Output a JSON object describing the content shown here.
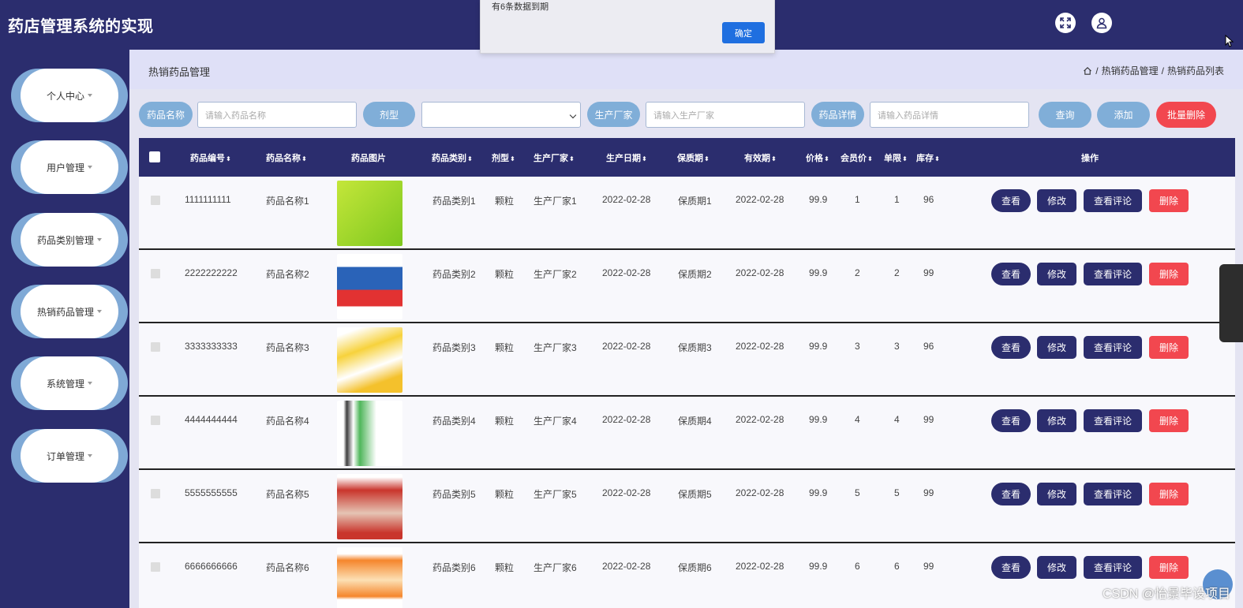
{
  "app": {
    "title": "药店管理系统的实现"
  },
  "dialog": {
    "message": "有6条数据到期",
    "ok_label": "确定"
  },
  "sidebar": {
    "items": [
      {
        "label": "个人中心"
      },
      {
        "label": "用户管理"
      },
      {
        "label": "药品类别管理"
      },
      {
        "label": "热销药品管理"
      },
      {
        "label": "系统管理"
      },
      {
        "label": "订单管理"
      }
    ]
  },
  "breadcrumb": {
    "title": "热销药品管理",
    "path1": "热销药品管理",
    "sep": "/",
    "path2": "热销药品列表"
  },
  "search": {
    "name_label": "药品名称",
    "name_placeholder": "请输入药品名称",
    "form_label": "剂型",
    "maker_label": "生产厂家",
    "maker_placeholder": "请输入生产厂家",
    "detail_label": "药品详情",
    "detail_placeholder": "请输入药品详情",
    "query_label": "查询",
    "add_label": "添加",
    "batch_delete_label": "批量删除"
  },
  "table": {
    "headers": [
      "药品编号",
      "药品名称",
      "药品图片",
      "药品类别",
      "剂型",
      "生产厂家",
      "生产日期",
      "保质期",
      "有效期",
      "价格",
      "会员价",
      "单限",
      "库存",
      "操作"
    ],
    "rows": [
      {
        "code": "1111111111",
        "name": "药品名称1",
        "category": "药品类别1",
        "form": "颗粒",
        "maker": "生产厂家1",
        "prod_date": "2022-02-28",
        "shelf": "保质期1",
        "expiry": "2022-02-28",
        "price": "99.9",
        "member_price": "1",
        "limit": "1",
        "stock": "96"
      },
      {
        "code": "2222222222",
        "name": "药品名称2",
        "category": "药品类别2",
        "form": "颗粒",
        "maker": "生产厂家2",
        "prod_date": "2022-02-28",
        "shelf": "保质期2",
        "expiry": "2022-02-28",
        "price": "99.9",
        "member_price": "2",
        "limit": "2",
        "stock": "99"
      },
      {
        "code": "3333333333",
        "name": "药品名称3",
        "category": "药品类别3",
        "form": "颗粒",
        "maker": "生产厂家3",
        "prod_date": "2022-02-28",
        "shelf": "保质期3",
        "expiry": "2022-02-28",
        "price": "99.9",
        "member_price": "3",
        "limit": "3",
        "stock": "96"
      },
      {
        "code": "4444444444",
        "name": "药品名称4",
        "category": "药品类别4",
        "form": "颗粒",
        "maker": "生产厂家4",
        "prod_date": "2022-02-28",
        "shelf": "保质期4",
        "expiry": "2022-02-28",
        "price": "99.9",
        "member_price": "4",
        "limit": "4",
        "stock": "99"
      },
      {
        "code": "5555555555",
        "name": "药品名称5",
        "category": "药品类别5",
        "form": "颗粒",
        "maker": "生产厂家5",
        "prod_date": "2022-02-28",
        "shelf": "保质期5",
        "expiry": "2022-02-28",
        "price": "99.9",
        "member_price": "5",
        "limit": "5",
        "stock": "99"
      },
      {
        "code": "6666666666",
        "name": "药品名称6",
        "category": "药品类别6",
        "form": "颗粒",
        "maker": "生产厂家6",
        "prod_date": "2022-02-28",
        "shelf": "保质期6",
        "expiry": "2022-02-28",
        "price": "99.9",
        "member_price": "6",
        "limit": "6",
        "stock": "99"
      }
    ],
    "actions": {
      "view": "查看",
      "edit": "修改",
      "comments": "查看评论",
      "delete": "删除"
    }
  },
  "watermark": "CSDN @怡景毕设项目",
  "colors": {
    "primary": "#2b2d6e",
    "accent": "#80aed8",
    "danger": "#f2474f",
    "ok_button": "#1f6fe0"
  },
  "icons": {
    "fullscreen": "expand-icon",
    "user": "user-icon",
    "home": "home-icon"
  }
}
